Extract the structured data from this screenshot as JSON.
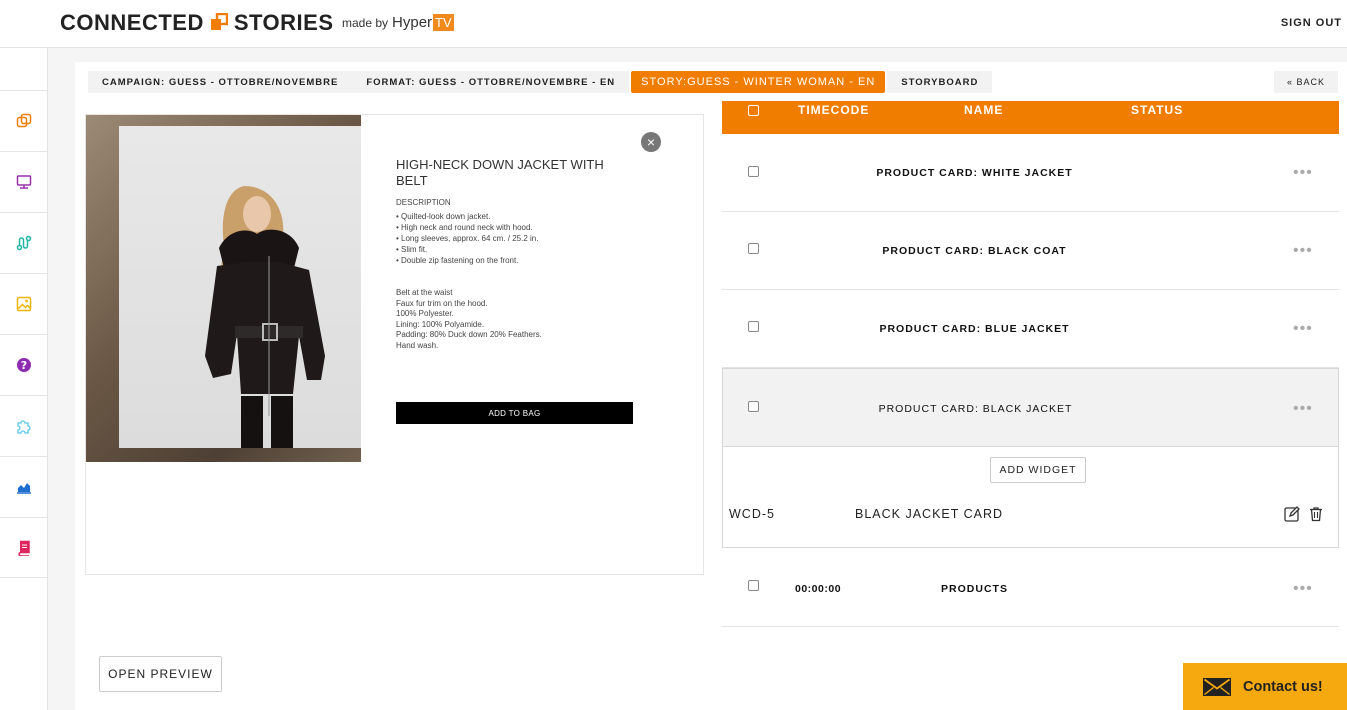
{
  "header": {
    "logo_left": "CONNECTED",
    "logo_right": "STORIES",
    "made_by": "made by",
    "hyper": "Hyper",
    "tv": "TV",
    "sign_out": "SIGN OUT",
    "accent_color": "#f07d00"
  },
  "sidebar": {
    "items": [
      {
        "icon": "copy-icon",
        "color": "#f07d00"
      },
      {
        "icon": "monitor-icon",
        "color": "#9b2fae"
      },
      {
        "icon": "route-icon",
        "color": "#1fb5a5"
      },
      {
        "icon": "image-icon",
        "color": "#f0b400"
      },
      {
        "icon": "help-icon",
        "color": "#8e2bb0"
      },
      {
        "icon": "puzzle-icon",
        "color": "#59c8e8"
      },
      {
        "icon": "chart-icon",
        "color": "#1f6fd1"
      },
      {
        "icon": "book-icon",
        "color": "#e0245e"
      }
    ]
  },
  "breadcrumbs": {
    "campaign": "CAMPAIGN: GUESS - OTTOBRE/NOVEMBRE",
    "format": "FORMAT: GUESS - OTTOBRE/NOVEMBRE - EN",
    "story": "STORY:GUESS - WINTER WOMAN - EN",
    "storyboard": "STORYBOARD",
    "back": "« BACK"
  },
  "preview": {
    "title": "HIGH-NECK DOWN JACKET WITH BELT",
    "description_heading": "DESCRIPTION",
    "bullets": [
      "Quilted-look down jacket.",
      "High neck and round neck with hood.",
      "Long sleeves, approx. 64 cm. / 25.2 in.",
      "Slim fit.",
      "Double zip fastening on the front."
    ],
    "details": [
      "Belt at the waist",
      "Faux fur trim on the hood.",
      "100% Polyester.",
      "Lining: 100% Polyamide.",
      "Padding: 80% Duck down 20% Feathers.",
      "Hand wash."
    ],
    "add_to_bag": "ADD TO BAG",
    "open_preview": "OPEN PREVIEW"
  },
  "table": {
    "headers": {
      "timecode": "TIMECODE",
      "name": "NAME",
      "status": "STATUS"
    },
    "rows": [
      {
        "timecode": "",
        "name": "PRODUCT CARD: WHITE JACKET"
      },
      {
        "timecode": "",
        "name": "PRODUCT CARD: BLACK COAT"
      },
      {
        "timecode": "",
        "name": "PRODUCT CARD: BLUE JACKET"
      },
      {
        "timecode": "",
        "name": "PRODUCT CARD: BLACK JACKET"
      },
      {
        "timecode": "00:00:00",
        "name": "PRODUCTS"
      }
    ],
    "more": "•••",
    "expanded": {
      "add_widget": "ADD WIDGET",
      "widget_id": "WCD-5",
      "widget_name": "BLACK JACKET CARD"
    }
  },
  "contact": {
    "label": "Contact us!",
    "color": "#f6a80f"
  }
}
